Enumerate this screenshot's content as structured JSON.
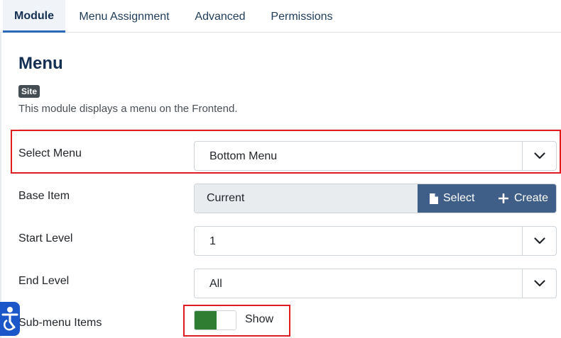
{
  "tabs": [
    {
      "label": "Module",
      "active": true
    },
    {
      "label": "Menu Assignment",
      "active": false
    },
    {
      "label": "Advanced",
      "active": false
    },
    {
      "label": "Permissions",
      "active": false
    }
  ],
  "module": {
    "title": "Menu",
    "badge": "Site",
    "description": "This module displays a menu on the Frontend."
  },
  "fields": {
    "select_menu": {
      "label": "Select Menu",
      "value": "Bottom Menu"
    },
    "base_item": {
      "label": "Base Item",
      "value": "Current",
      "select_label": "Select",
      "create_label": "Create"
    },
    "start_level": {
      "label": "Start Level",
      "value": "1"
    },
    "end_level": {
      "label": "End Level",
      "value": "All"
    },
    "submenu_items": {
      "label": "Sub-menu Items",
      "value": "Show",
      "enabled": true
    }
  },
  "colors": {
    "accent": "#2a69b8",
    "button": "#3f5e88",
    "toggle_on": "#2e7d32",
    "highlight": "#e01b22",
    "a11y": "#1c57c9"
  },
  "icons": {
    "chevron": "chevron-down-icon",
    "select": "file-icon",
    "create": "plus-icon",
    "accessibility": "accessibility-icon"
  }
}
